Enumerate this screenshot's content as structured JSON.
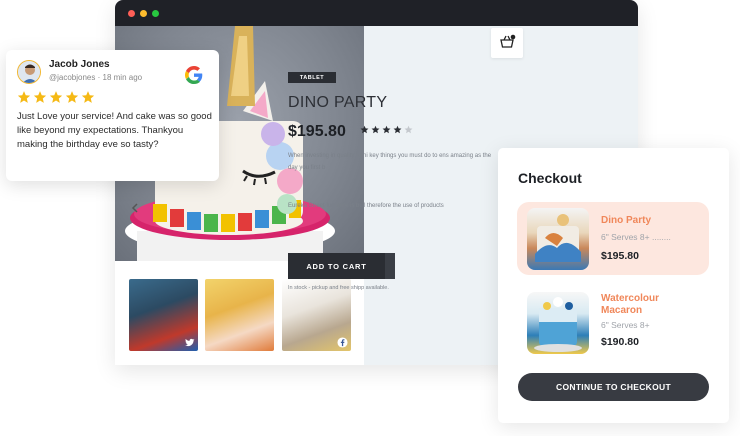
{
  "review": {
    "name": "Jacob Jones",
    "handle": "@jacobjones",
    "time": "18 min ago",
    "stars": 5,
    "text": "Just Love your service! And cake was so good like beyond my expectations. Thankyou making the birthday eve so tasty?",
    "source_icon": "google-icon"
  },
  "product": {
    "badge": "TABLET",
    "title": "DINO PARTY",
    "price": "$195.80",
    "rating": 4,
    "rating_max": 5,
    "desc1": "When investing in quality furni key things you must do to ens amazing as the day you first b",
    "desc2": "Eureka Street furniture is buil therefore the use of products",
    "add_to_cart": "ADD TO CART",
    "stock": "In stock - pickup and free shipp available."
  },
  "gallery": {
    "thumbs": [
      {
        "social_icon": "twitter-icon"
      },
      {
        "social_icon": "none"
      },
      {
        "social_icon": "facebook-icon"
      }
    ]
  },
  "checkout": {
    "title": "Checkout",
    "items": [
      {
        "name": "Dino Party",
        "sub": "6\" Serves 8+ ........",
        "price": "$195.80"
      },
      {
        "name": "Watercolour Macaron",
        "sub": "6\" Serves 8+",
        "price": "$190.80"
      }
    ],
    "continue_label": "CONTINUE TO CHECKOUT"
  },
  "colors": {
    "accent": "#f0875a",
    "dark_button": "#2a2d33",
    "star": "#f5b915",
    "highlight_bg": "#fde7df"
  }
}
